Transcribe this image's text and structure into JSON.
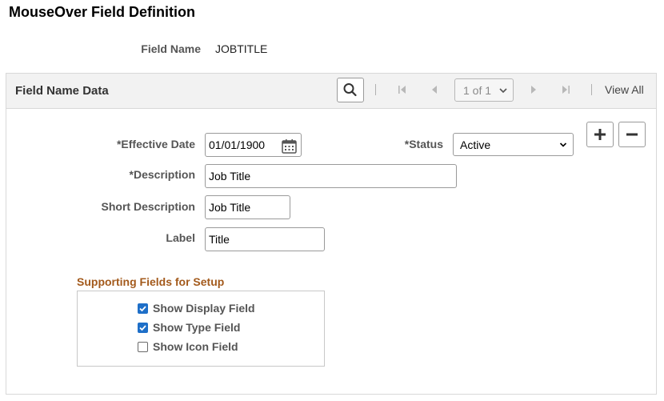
{
  "page": {
    "title": "MouseOver Field Definition"
  },
  "field_name": {
    "label": "Field Name",
    "value": "JOBTITLE"
  },
  "panel": {
    "title": "Field Name Data",
    "pagination": {
      "current": "1 of 1",
      "view_all": "View All"
    }
  },
  "form": {
    "effective_date": {
      "label": "*Effective Date",
      "value": "01/01/1900"
    },
    "status": {
      "label": "*Status",
      "value": "Active"
    },
    "description": {
      "label": "*Description",
      "value": "Job Title"
    },
    "short_description": {
      "label": "Short Description",
      "value": "Job Title"
    },
    "label": {
      "label": "Label",
      "value": "Title"
    }
  },
  "supporting": {
    "title": "Supporting Fields for Setup",
    "items": [
      {
        "label": "Show Display Field",
        "checked": true
      },
      {
        "label": "Show Type Field",
        "checked": true
      },
      {
        "label": "Show Icon Field",
        "checked": false
      }
    ]
  },
  "colors": {
    "accent_check": "#1e6fc8",
    "section_title": "#a35a1c",
    "header_bg": "#f2f2f2"
  }
}
